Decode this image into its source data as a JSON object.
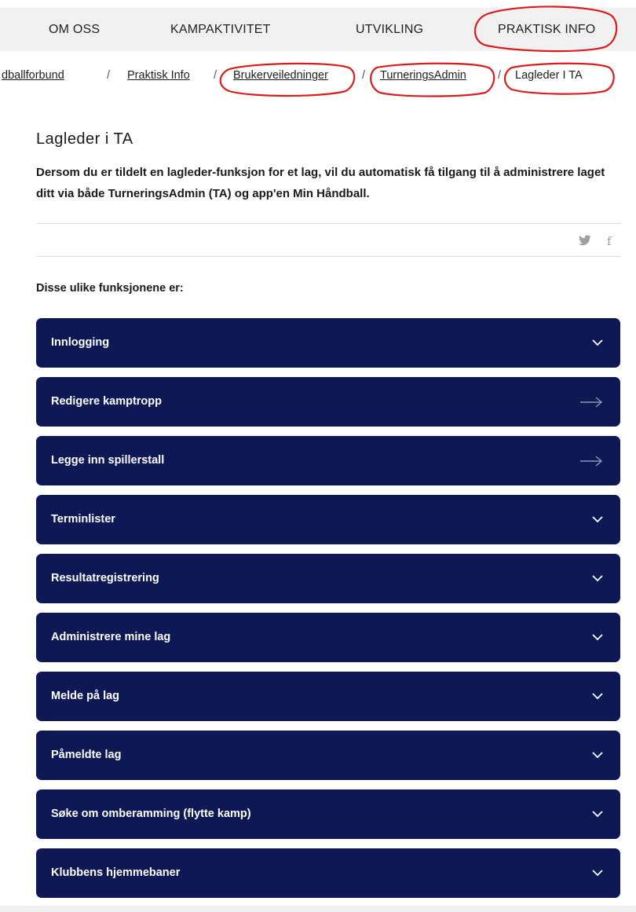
{
  "nav": {
    "items": [
      {
        "label": "OM OSS"
      },
      {
        "label": "KAMPAKTIVITET"
      },
      {
        "label": "UTVIKLING"
      },
      {
        "label": "PRAKTISK INFO"
      }
    ]
  },
  "breadcrumb": {
    "items": [
      {
        "label": "dballforbund"
      },
      {
        "label": "Praktisk Info"
      },
      {
        "label": "Brukerveiledninger"
      },
      {
        "label": "TurneringsAdmin"
      },
      {
        "label": "Lagleder I TA"
      }
    ],
    "separator": "/"
  },
  "page": {
    "title": "Lagleder i TA",
    "lead": "Dersom du er tildelt en lagleder-funksjon for et lag, vil du automatisk få tilgang til å administrere laget ditt via både TurneringsAdmin (TA) og app'en Min Håndball.",
    "subheading": "Disse ulike funksjonene er:"
  },
  "share": {
    "icons": [
      "twitter-icon",
      "facebook-icon"
    ],
    "twitter_glyph": "🐦",
    "facebook_glyph": "f"
  },
  "accordion": [
    {
      "label": "Innlogging",
      "icon": "chevron-down-icon"
    },
    {
      "label": "Redigere kamptropp",
      "icon": "arrow-right-icon"
    },
    {
      "label": "Legge inn spillerstall",
      "icon": "arrow-right-icon"
    },
    {
      "label": "Terminlister",
      "icon": "chevron-down-icon"
    },
    {
      "label": "Resultatregistrering",
      "icon": "chevron-down-icon"
    },
    {
      "label": "Administrere mine lag",
      "icon": "chevron-down-icon"
    },
    {
      "label": "Melde på lag",
      "icon": "chevron-down-icon"
    },
    {
      "label": "Påmeldte lag",
      "icon": "chevron-down-icon"
    },
    {
      "label": "Søke om omberamming (flytte kamp)",
      "icon": "chevron-down-icon"
    },
    {
      "label": "Klubbens hjemmebaner",
      "icon": "chevron-down-icon"
    }
  ],
  "colors": {
    "accordion_bg": "#0d1854",
    "nav_bg": "#f1f1f1",
    "annotation_red": "#d91c1c"
  }
}
